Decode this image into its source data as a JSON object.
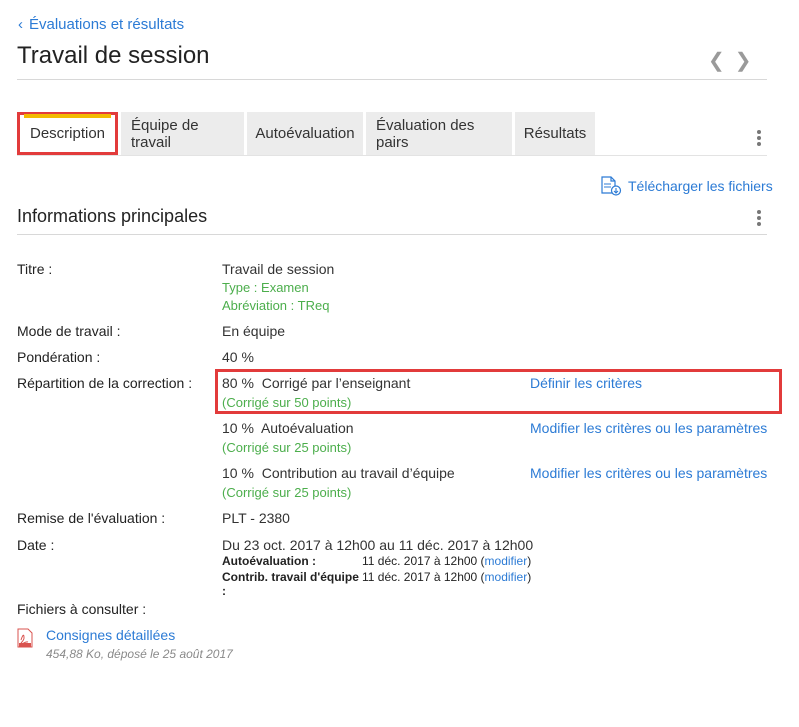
{
  "breadcrumb": {
    "label": "Évaluations et résultats"
  },
  "page": {
    "title": "Travail de session"
  },
  "tabs": [
    {
      "label": "Description"
    },
    {
      "label": "Équipe de travail"
    },
    {
      "label": "Autoévaluation"
    },
    {
      "label": "Évaluation des pairs"
    },
    {
      "label": "Résultats"
    }
  ],
  "download": {
    "label": "Télécharger les fichiers"
  },
  "section": {
    "title": "Informations principales"
  },
  "info": {
    "titre_label": "Titre :",
    "titre_value": "Travail de session",
    "type": "Type : Examen",
    "abbr": "Abréviation : TReq",
    "mode_label": "Mode de travail :",
    "mode_value": "En équipe",
    "ponderation_label": "Pondération :",
    "ponderation_value": "40 %",
    "repartition_label": "Répartition de la correction :",
    "corrections": [
      {
        "pct": "80 %",
        "desc": "Corrigé par l’enseignant",
        "points": "(Corrigé sur 50 points)",
        "action": "Définir les critères"
      },
      {
        "pct": "10 %",
        "desc": "Autoévaluation",
        "points": "(Corrigé sur 25 points)",
        "action": "Modifier les critères ou les paramètres"
      },
      {
        "pct": "10 %",
        "desc": "Contribution au travail d’équipe",
        "points": "(Corrigé sur 25 points)",
        "action": "Modifier les critères ou les paramètres"
      }
    ],
    "remise_label": "Remise de l'évaluation :",
    "remise_value": "PLT - 2380",
    "date_label": "Date :",
    "date_value": "Du 23 oct. 2017 à 12h00 au 11 déc. 2017 à 12h00",
    "date_sub": [
      {
        "label": "Autoévaluation :",
        "value": "11 déc. 2017 à 12h00 (",
        "link": "modifier",
        "close": ")"
      },
      {
        "label": "Contrib. travail d'équipe :",
        "value": "11 déc. 2017 à 12h00 (",
        "link": "modifier",
        "close": ")"
      }
    ],
    "files_label": "Fichiers à consulter :",
    "file_name": "Consignes détaillées",
    "file_meta": "454,88 Ko, déposé le 25 août 2017"
  },
  "colors": {
    "link": "#2c7bd5",
    "green": "#4cae4c",
    "highlight": "#e23b3b",
    "tab_accent": "#f3b900"
  }
}
